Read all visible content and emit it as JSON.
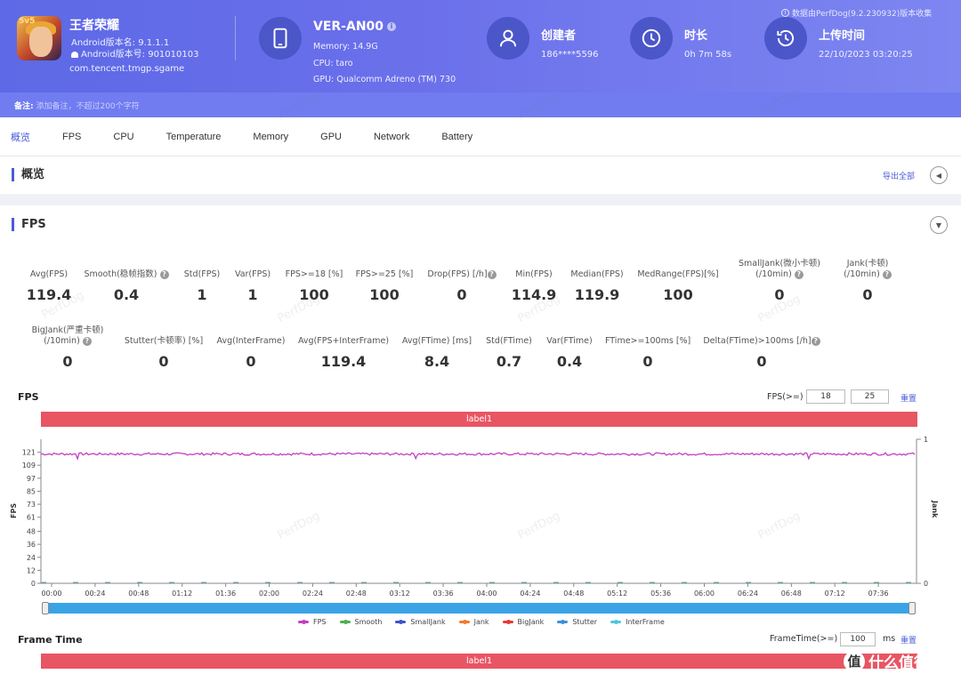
{
  "header": {
    "app": {
      "name": "王者荣耀",
      "android_version_name": "Android版本名: 9.1.1.1",
      "android_version_code": "Android版本号: 901010103",
      "package": "com.tencent.tmgp.sgame",
      "icon_badge": "5v5"
    },
    "device": {
      "name": "VER-AN00",
      "memory": "Memory: 14.9G",
      "cpu": "CPU: taro",
      "gpu": "GPU: Qualcomm Adreno (TM) 730"
    },
    "creator": {
      "title": "创建者",
      "value": "186****5596"
    },
    "duration": {
      "title": "时长",
      "value": "0h 7m 58s"
    },
    "upload": {
      "title": "上传时间",
      "value": "22/10/2023 03:20:25"
    },
    "source_note": "数据由PerfDog(9.2.230932)版本收集"
  },
  "note": {
    "label": "备注:",
    "placeholder": "添加备注，不超过200个字符"
  },
  "tabs": [
    "概览",
    "FPS",
    "CPU",
    "Temperature",
    "Memory",
    "GPU",
    "Network",
    "Battery"
  ],
  "overview": {
    "title": "概览",
    "export_label": "导出全部"
  },
  "fps_section": {
    "title": "FPS",
    "stats_row1": [
      {
        "key": "Avg(FPS)",
        "value": "119.4"
      },
      {
        "key": "Smooth(稳帧指数)",
        "value": "0.4",
        "help": true
      },
      {
        "key": "Std(FPS)",
        "value": "1"
      },
      {
        "key": "Var(FPS)",
        "value": "1"
      },
      {
        "key": "FPS>=18 [%]",
        "value": "100"
      },
      {
        "key": "FPS>=25 [%]",
        "value": "100"
      },
      {
        "key": "Drop(FPS) [/h]",
        "value": "0",
        "help": true
      },
      {
        "key": "Min(FPS)",
        "value": "114.9"
      },
      {
        "key": "Median(FPS)",
        "value": "119.9"
      },
      {
        "key": "MedRange(FPS)[%]",
        "value": "100"
      },
      {
        "key": "SmallJank(微小卡顿)",
        "key2": "(/10min)",
        "value": "0",
        "help": true
      },
      {
        "key": "Jank(卡顿)",
        "key2": "(/10min)",
        "value": "0",
        "help": true
      }
    ],
    "stats_row2": [
      {
        "key": "BigJank(严重卡顿)",
        "key2": "(/10min)",
        "value": "0",
        "help": true
      },
      {
        "key": "Stutter(卡顿率) [%]",
        "value": "0"
      },
      {
        "key": "Avg(InterFrame)",
        "value": "0"
      },
      {
        "key": "Avg(FPS+InterFrame)",
        "value": "119.4"
      },
      {
        "key": "Avg(FTime) [ms]",
        "value": "8.4"
      },
      {
        "key": "Std(FTime)",
        "value": "0.7"
      },
      {
        "key": "Var(FTime)",
        "value": "0.4"
      },
      {
        "key": "FTime>=100ms [%]",
        "value": "0"
      },
      {
        "key": "Delta(FTime)>100ms [/h]",
        "value": "0",
        "help": true
      }
    ],
    "chart_title": "FPS",
    "threshold_label": "FPS(>=)",
    "threshold_1": "18",
    "threshold_2": "25",
    "reset_label": "重置",
    "label_bar": "label1"
  },
  "frame_time": {
    "title": "Frame Time",
    "threshold_label": "FrameTime(>=)",
    "threshold_value": "100",
    "unit": "ms",
    "reset_label": "重置",
    "label_bar": "label1"
  },
  "watermark": "PerfDog",
  "corner_brand": {
    "logo": "值",
    "text": "什么值得买"
  },
  "chart_data": {
    "type": "line",
    "ylabel": "FPS",
    "y2label": "Jank",
    "y_ticks": [
      0,
      12,
      24,
      36,
      48,
      61,
      73,
      85,
      97,
      109,
      121
    ],
    "ylim": [
      0,
      133
    ],
    "y2_ticks": [
      0,
      1
    ],
    "x_ticks": [
      "00:00",
      "00:24",
      "00:48",
      "01:12",
      "01:36",
      "02:00",
      "02:24",
      "02:48",
      "03:12",
      "03:36",
      "04:00",
      "04:24",
      "04:48",
      "05:12",
      "05:36",
      "06:00",
      "06:24",
      "06:48",
      "07:12",
      "07:36"
    ],
    "duration_sec": 478,
    "series": [
      {
        "name": "FPS",
        "color": "#c23fc2",
        "mean": 119.4,
        "min": 114.9,
        "max": 121
      },
      {
        "name": "Smooth",
        "color": "#4caf50"
      },
      {
        "name": "SmallJank",
        "color": "#3f51c6"
      },
      {
        "name": "Jank",
        "color": "#f07b2d"
      },
      {
        "name": "BigJank",
        "color": "#e53935"
      },
      {
        "name": "Stutter",
        "color": "#3b8fd9"
      },
      {
        "name": "InterFrame",
        "color": "#4fc7d9"
      }
    ]
  }
}
